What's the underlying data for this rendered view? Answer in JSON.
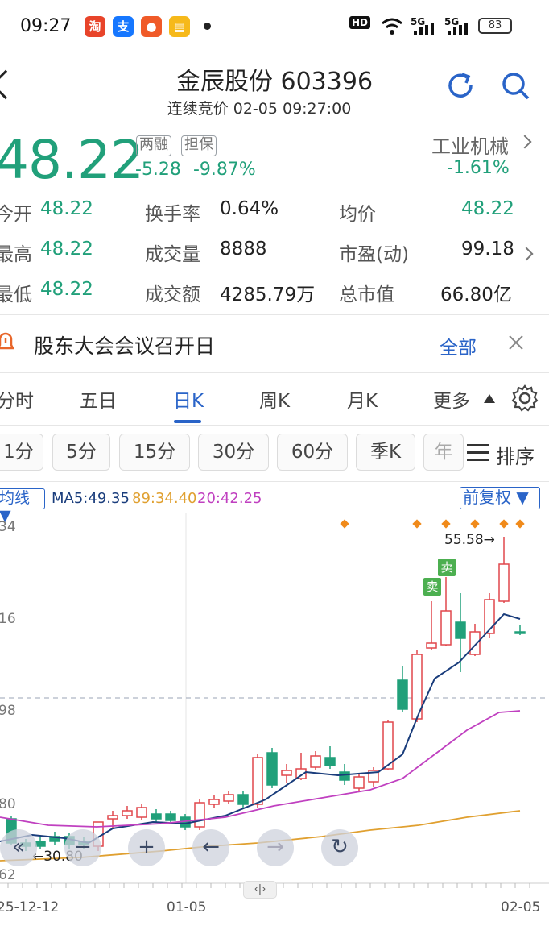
{
  "status": {
    "time": "09:27",
    "battery": "83",
    "net1": "5G",
    "net2": "5G",
    "hd": "HD"
  },
  "header": {
    "title": "金辰股份 603396",
    "subtitle": "连续竞价 02-05 09:27:00"
  },
  "quote": {
    "price": "48.22",
    "tag1": "两融",
    "tag2": "担保",
    "change": "-5.28",
    "change_pct": "-9.87%",
    "industry": "工业机械",
    "industry_pct": "-1.61%"
  },
  "stats": {
    "open_label": "今开",
    "open": "48.22",
    "high_label": "最高",
    "high": "48.22",
    "low_label": "最低",
    "low": "48.22",
    "turnover_label": "换手率",
    "turnover": "0.64%",
    "volume_label": "成交量",
    "volume": "8888",
    "amount_label": "成交额",
    "amount": "4285.79万",
    "avg_label": "均价",
    "avg": "48.22",
    "pe_label": "市盈(动)",
    "pe": "99.18",
    "mcap_label": "总市值",
    "mcap": "66.80亿"
  },
  "notice": {
    "text": "股东大会会议召开日",
    "all": "全部"
  },
  "tabs": [
    "分时",
    "五日",
    "日K",
    "周K",
    "月K",
    "更多"
  ],
  "minute_buttons": [
    "1分",
    "5分",
    "15分",
    "30分",
    "60分",
    "季K",
    "年"
  ],
  "sort_label": "排序",
  "ma": {
    "dropdown": "均线",
    "ma5": "MA5:49.35",
    "ma10": "89:34.40",
    "ma20": "20:42.25",
    "adjust": "前复权",
    "color_ma5": "#1a3d7c",
    "color_ma10": "#e0a030",
    "color_ma20": "#c040c0"
  },
  "chart_data": {
    "type": "candlestick",
    "y_tick_labels": [
      "34",
      "16",
      "98",
      "80",
      "62"
    ],
    "x_tick_labels": [
      "25-12-12",
      "01-05",
      "02-05"
    ],
    "annotations": [
      "55.58→",
      "←30.80"
    ],
    "sell_marks": [
      "卖",
      "卖"
    ],
    "up_color": "#e0474c",
    "down_color": "#21a07a"
  }
}
